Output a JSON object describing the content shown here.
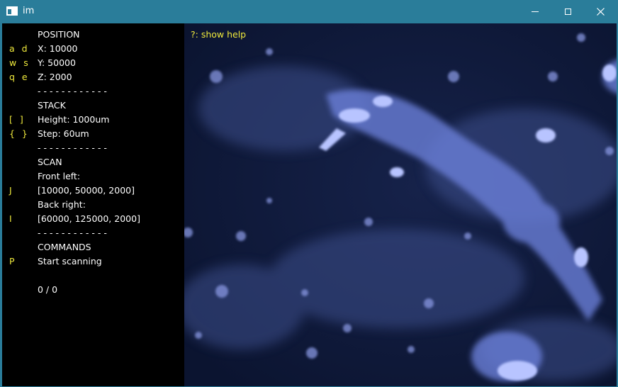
{
  "window": {
    "title": "im",
    "icon": "app-window-icon",
    "controls": [
      "minimize-icon",
      "maximize-icon",
      "close-icon"
    ]
  },
  "panel": {
    "position_header": "POSITION",
    "x": {
      "key": "a d",
      "label": "X: 10000"
    },
    "y": {
      "key": "w s",
      "label": "Y: 50000"
    },
    "z": {
      "key": "q e",
      "label": "Z: 2000"
    },
    "divider": "- - - - - - - - - - - -",
    "stack_header": "STACK",
    "height": {
      "key": "[ ]",
      "label": "Height: 1000um"
    },
    "step": {
      "key": "{ }",
      "label": "Step: 60um"
    },
    "scan_header": "SCAN",
    "front_left_label": "Front left:",
    "front_left": {
      "key": "J",
      "label": "[10000, 50000, 2000]"
    },
    "back_right_label": "Back right:",
    "back_right": {
      "key": "I",
      "label": "[60000, 125000, 2000]"
    },
    "commands_header": "COMMANDS",
    "start": {
      "key": "P",
      "label": "Start scanning"
    },
    "progress": "0 / 0"
  },
  "image": {
    "help_text": "?: show help",
    "colors": {
      "background": "#0e1838",
      "glow": "#7f8fe6",
      "highlight": "#d6dcff"
    }
  },
  "colors": {
    "titlebar": "#2a7d9a",
    "key_text": "#f0ea3c",
    "value_text": "#ffffff",
    "panel_bg": "#000000"
  }
}
